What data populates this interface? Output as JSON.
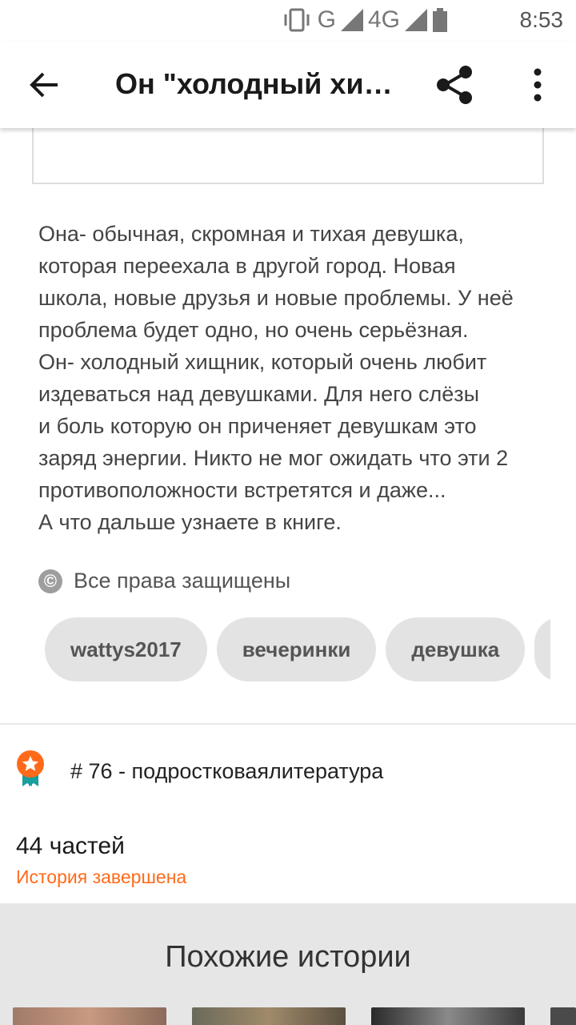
{
  "status_bar": {
    "time": "8:53",
    "network": "G",
    "network2": "4G",
    "icons": [
      "vibrate-icon",
      "signal-icon",
      "signal-4g-icon",
      "battery-icon"
    ]
  },
  "app_bar": {
    "title": "Он \"холодный хищник\"",
    "back_icon": "arrow-left-icon",
    "share_icon": "share-icon",
    "more_icon": "more-vertical-icon"
  },
  "description": [
    "Она- обычная, скромная и тихая девушка,",
    "которая переехала в другой город. Новая",
    "школа, новые друзья и новые проблемы. У неё",
    "проблема будет одно, но очень серьёзная.",
    "Он- холодный хищник, который очень любит",
    "издеваться над девушками. Для него слёзы",
    "и боль которую он приченяет девушкам это",
    "заряд энергии. Никто не мог ожидать что эти 2",
    "противоположности встретятся и даже...",
    "А что дальше узнаете в книге."
  ],
  "copyright": {
    "icon": "copyright-icon",
    "text": "Все права защищены"
  },
  "tags": [
    "wattys2017",
    "вечеринки",
    "девушка",
    ""
  ],
  "ranking": {
    "icon": "medal-icon",
    "text": "# 76 - подростковаялитература"
  },
  "parts": {
    "count": "44 частей",
    "status": "История завершена"
  },
  "similar": {
    "heading": "Похожие истории"
  },
  "colors": {
    "accent": "#ff6a1a",
    "tag_bg": "#e3e3e3",
    "similar_bg": "#e6e6e6"
  }
}
